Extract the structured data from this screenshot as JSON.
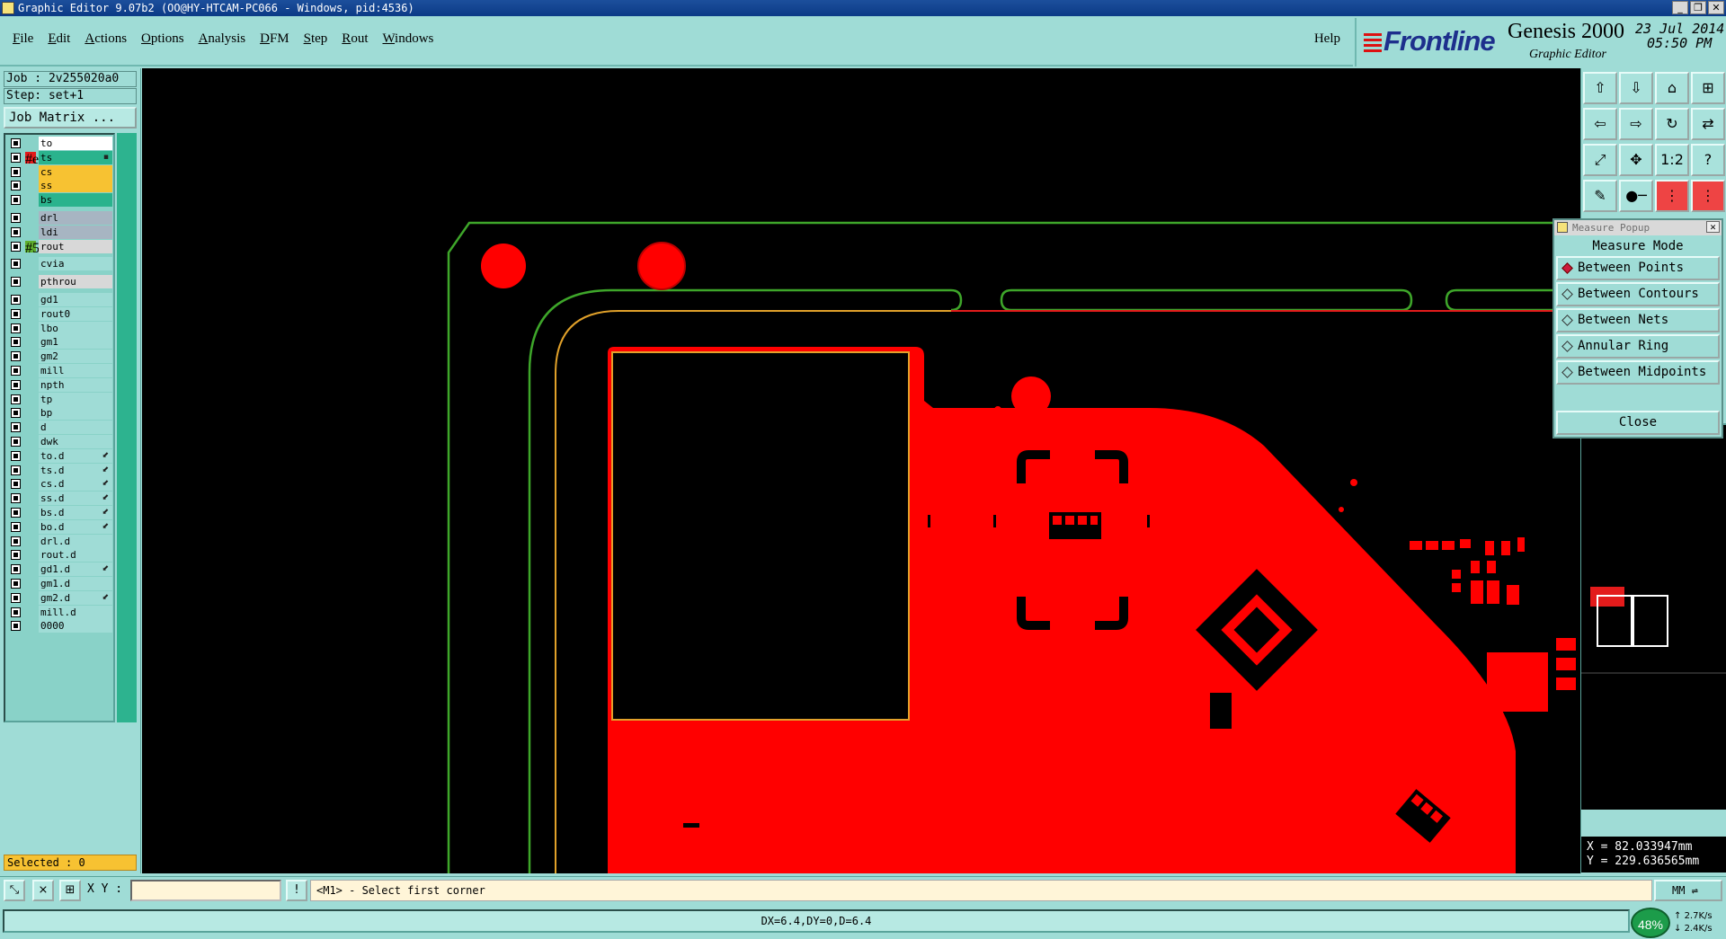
{
  "window": {
    "title": "Graphic Editor 9.07b2 (OO@HY-HTCAM-PC066 - Windows, pid:4536)",
    "controls": [
      "_",
      "❐",
      "✕"
    ]
  },
  "menu": {
    "items": [
      "File",
      "Edit",
      "Actions",
      "Options",
      "Analysis",
      "DFM",
      "Step",
      "Rout",
      "Windows"
    ],
    "help": "Help"
  },
  "brand": {
    "logo": "Frontline",
    "product": "Genesis 2000",
    "subtitle": "Graphic Editor",
    "date": "23 Jul 2014",
    "time": "05:50 PM"
  },
  "job": {
    "job_line": "Job : 2v255020a0",
    "step_line": "Step: set+1",
    "matrix_button": "Job Matrix ..."
  },
  "layers": [
    {
      "name": "to",
      "color": "#ffffff",
      "swatch": "",
      "mark": ""
    },
    {
      "name": "ts",
      "color": "#2ab38d",
      "swatch": "#e31b1b",
      "mark": "▪"
    },
    {
      "name": "cs",
      "color": "#f7c232",
      "swatch": "",
      "mark": ""
    },
    {
      "name": "ss",
      "color": "#f7c232",
      "swatch": "",
      "mark": ""
    },
    {
      "name": "bs",
      "color": "#2ab38d",
      "swatch": "",
      "mark": ""
    },
    {
      "name": "drl",
      "color": "#a7b5c2",
      "swatch": "",
      "mark": ""
    },
    {
      "name": "ldi",
      "color": "#a7b5c2",
      "swatch": "",
      "mark": ""
    },
    {
      "name": "rout",
      "color": "#d8d8d8",
      "swatch": "#5fae2e",
      "mark": ""
    },
    {
      "name": "cvia",
      "color": "#9fdcd6",
      "swatch": "",
      "mark": ""
    },
    {
      "name": "pthrou",
      "color": "#d8d8d8",
      "swatch": "",
      "mark": ""
    },
    {
      "name": "gd1",
      "color": "#9fdcd6",
      "swatch": "",
      "mark": ""
    },
    {
      "name": "rout0",
      "color": "#9fdcd6",
      "swatch": "",
      "mark": ""
    },
    {
      "name": "lbo",
      "color": "#9fdcd6",
      "swatch": "",
      "mark": ""
    },
    {
      "name": "gm1",
      "color": "#9fdcd6",
      "swatch": "",
      "mark": ""
    },
    {
      "name": "gm2",
      "color": "#9fdcd6",
      "swatch": "",
      "mark": ""
    },
    {
      "name": "mill",
      "color": "#9fdcd6",
      "swatch": "",
      "mark": ""
    },
    {
      "name": "npth",
      "color": "#9fdcd6",
      "swatch": "",
      "mark": ""
    },
    {
      "name": "tp",
      "color": "#9fdcd6",
      "swatch": "",
      "mark": ""
    },
    {
      "name": "bp",
      "color": "#9fdcd6",
      "swatch": "",
      "mark": ""
    },
    {
      "name": "d",
      "color": "#9fdcd6",
      "swatch": "",
      "mark": ""
    },
    {
      "name": "dwk",
      "color": "#9fdcd6",
      "swatch": "",
      "mark": ""
    },
    {
      "name": "to.d",
      "color": "#9fdcd6",
      "swatch": "",
      "mark": "⬋"
    },
    {
      "name": "ts.d",
      "color": "#9fdcd6",
      "swatch": "",
      "mark": "⬋"
    },
    {
      "name": "cs.d",
      "color": "#9fdcd6",
      "swatch": "",
      "mark": "⬋"
    },
    {
      "name": "ss.d",
      "color": "#9fdcd6",
      "swatch": "",
      "mark": "⬋"
    },
    {
      "name": "bs.d",
      "color": "#9fdcd6",
      "swatch": "",
      "mark": "⬋"
    },
    {
      "name": "bo.d",
      "color": "#9fdcd6",
      "swatch": "",
      "mark": "⬋"
    },
    {
      "name": "drl.d",
      "color": "#9fdcd6",
      "swatch": "",
      "mark": ""
    },
    {
      "name": "rout.d",
      "color": "#9fdcd6",
      "swatch": "",
      "mark": ""
    },
    {
      "name": "gd1.d",
      "color": "#9fdcd6",
      "swatch": "",
      "mark": "⬋"
    },
    {
      "name": "gm1.d",
      "color": "#9fdcd6",
      "swatch": "",
      "mark": ""
    },
    {
      "name": "gm2.d",
      "color": "#9fdcd6",
      "swatch": "",
      "mark": "⬋"
    },
    {
      "name": "mill.d",
      "color": "#9fdcd6",
      "swatch": "",
      "mark": ""
    },
    {
      "name": "0000",
      "color": "#9fdcd6",
      "swatch": "",
      "mark": ""
    }
  ],
  "selected": "Selected : 0",
  "tools": [
    {
      "icon": "⇧",
      "name": "tool-up-icon",
      "red": false
    },
    {
      "icon": "⇩",
      "name": "tool-down-icon",
      "red": false
    },
    {
      "icon": "⌂",
      "name": "tool-home-icon",
      "red": false
    },
    {
      "icon": "⊞",
      "name": "tool-grid-icon",
      "red": false
    },
    {
      "icon": "⇦",
      "name": "tool-left-icon",
      "red": false
    },
    {
      "icon": "⇨",
      "name": "tool-right-icon",
      "red": false
    },
    {
      "icon": "↻",
      "name": "tool-rotate-icon",
      "red": false
    },
    {
      "icon": "⇄",
      "name": "tool-swap-icon",
      "red": false
    },
    {
      "icon": "⤢",
      "name": "tool-fit-icon",
      "red": false
    },
    {
      "icon": "✥",
      "name": "tool-pan-icon",
      "red": false
    },
    {
      "icon": "1:2",
      "name": "tool-scale-icon",
      "red": false
    },
    {
      "icon": "?",
      "name": "tool-help-icon",
      "red": false
    },
    {
      "icon": "✎",
      "name": "tool-edit-icon",
      "red": false
    },
    {
      "icon": "●─",
      "name": "tool-snap-icon",
      "red": false
    },
    {
      "icon": "⋮",
      "name": "tool-layer-a-icon",
      "red": true
    },
    {
      "icon": "⋮",
      "name": "tool-layer-b-icon",
      "red": true
    }
  ],
  "measure": {
    "title": "Measure Popup",
    "mode_label": "Measure Mode",
    "options": [
      {
        "label": "Between Points",
        "selected": true
      },
      {
        "label": "Between Contours",
        "selected": false
      },
      {
        "label": "Between Nets",
        "selected": false
      },
      {
        "label": "Annular Ring",
        "selected": false
      },
      {
        "label": "Between Midpoints",
        "selected": false
      }
    ],
    "close_label": "Close",
    "close_icon": "✕"
  },
  "coords": {
    "x": "X = 82.033947mm",
    "y": "Y = 229.63656​5mm"
  },
  "command": {
    "xy_label": "X Y :",
    "xy_value": "",
    "prompt": "<M1> - Select first corner",
    "units": "MM"
  },
  "status": {
    "dx": "DX=6.4,DY=0,D=6.4",
    "perf": "48%",
    "net_up": "2.7K/s",
    "net_down": "2.4K/s"
  },
  "colors": {
    "copper": "#ff0000",
    "rout_green": "#3ea62a",
    "outline_yellow": "#e1a12a",
    "background": "#000000"
  }
}
